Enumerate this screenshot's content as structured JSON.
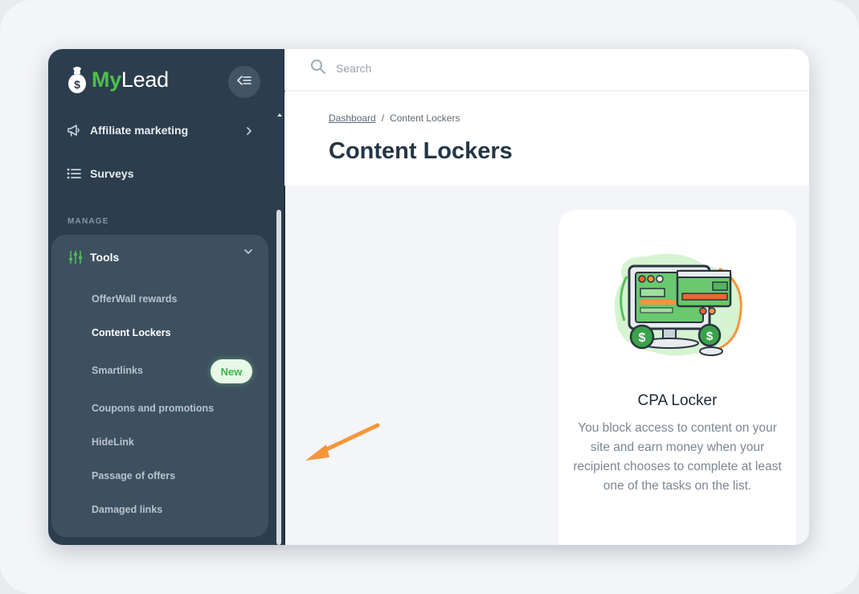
{
  "app": {
    "logo_my": "My",
    "logo_lead": "Lead"
  },
  "sidebar": {
    "nav_items": [
      {
        "label": "Affiliate marketing",
        "icon": "megaphone-icon",
        "has_submenu": true
      },
      {
        "label": "Surveys",
        "icon": "list-icon"
      }
    ],
    "section_label": "MANAGE",
    "tools": {
      "label": "Tools",
      "icon": "sliders-icon",
      "expanded": true,
      "items": [
        {
          "label": "OfferWall rewards"
        },
        {
          "label": "Content Lockers",
          "active": true
        },
        {
          "label": "Smartlinks",
          "badge": "New"
        },
        {
          "label": "Coupons and promotions"
        },
        {
          "label": "HideLink"
        },
        {
          "label": "Passage of offers"
        },
        {
          "label": "Damaged links"
        }
      ]
    }
  },
  "search": {
    "placeholder": "Search"
  },
  "breadcrumb": {
    "home": "Dashboard",
    "separator": "/",
    "current": "Content Lockers"
  },
  "page": {
    "title": "Content Lockers"
  },
  "card": {
    "title": "CPA Locker",
    "description": "You block access to content on your site and earn money when your recipient chooses to complete at least one of the tasks on the list."
  },
  "colors": {
    "sidebar_bg": "#2c3e4e",
    "tools_panel_bg": "#3d5060",
    "brand_green": "#4cc04c",
    "accent_orange": "#f5963a",
    "title_color": "#243646"
  }
}
